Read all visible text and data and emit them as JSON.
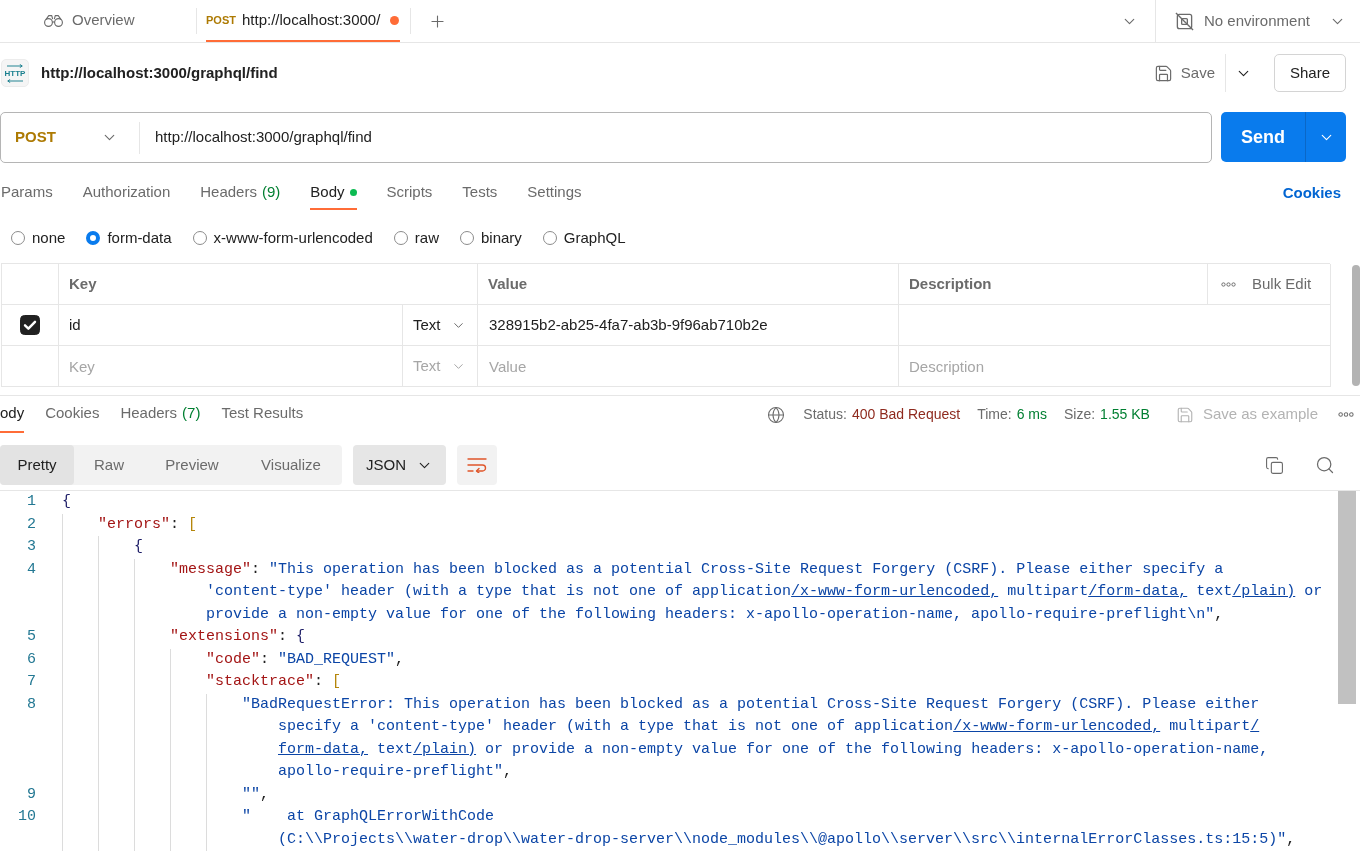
{
  "tabs": [
    {
      "kind": "overview",
      "label": "Overview",
      "selected": false,
      "unsaved": false
    },
    {
      "kind": "request",
      "method": "POST",
      "label": "http://localhost:3000/",
      "selected": true,
      "unsaved": true
    }
  ],
  "environment": {
    "label": "No environment"
  },
  "request": {
    "icon_label": "HTTP",
    "title": "http://localhost:3000/graphql/find",
    "save_label": "Save",
    "share_label": "Share",
    "method": "POST",
    "url": "http://localhost:3000/graphql/find",
    "send_label": "Send"
  },
  "request_tabs": [
    {
      "label": "Params",
      "selected": false,
      "dot": false
    },
    {
      "label": "Authorization",
      "selected": false,
      "dot": false
    },
    {
      "label": "Headers",
      "count": "(9)",
      "selected": false,
      "dot": false
    },
    {
      "label": "Body",
      "selected": true,
      "dot": true
    },
    {
      "label": "Scripts",
      "selected": false,
      "dot": false
    },
    {
      "label": "Tests",
      "selected": false,
      "dot": false
    },
    {
      "label": "Settings",
      "selected": false,
      "dot": false
    }
  ],
  "cookies_link": "Cookies",
  "body_types": [
    {
      "label": "none",
      "selected": false
    },
    {
      "label": "form-data",
      "selected": true
    },
    {
      "label": "x-www-form-urlencoded",
      "selected": false
    },
    {
      "label": "raw",
      "selected": false
    },
    {
      "label": "binary",
      "selected": false
    },
    {
      "label": "GraphQL",
      "selected": false
    }
  ],
  "form_table": {
    "columns": [
      "Key",
      "Value",
      "Description"
    ],
    "bulk_edit": "Bulk Edit",
    "rows": [
      {
        "checked": true,
        "key": "id",
        "type": "Text",
        "value": "328915b2-ab25-4fa7-ab3b-9f96ab710b2e"
      }
    ],
    "new_row": {
      "key_placeholder": "Key",
      "type": "Text",
      "value_placeholder": "Value",
      "description_placeholder": "Description"
    }
  },
  "response": {
    "tabs": [
      {
        "label": "ody",
        "selected": true
      },
      {
        "label": "Cookies",
        "selected": false
      },
      {
        "label": "Headers",
        "count": "(7)",
        "selected": false
      },
      {
        "label": "Test Results",
        "selected": false
      }
    ],
    "status_label": "Status:",
    "status": "400 Bad Request",
    "time_label": "Time:",
    "time": "6 ms",
    "size_label": "Size:",
    "size": "1.55 KB",
    "save_example": {
      "label": "Save as example",
      "disabled": true
    },
    "views": [
      {
        "label": "Pretty",
        "selected": true
      },
      {
        "label": "Raw",
        "selected": false
      },
      {
        "label": "Preview",
        "selected": false
      },
      {
        "label": "Visualize",
        "selected": false
      }
    ],
    "format": "JSON",
    "code_lines": [
      {
        "number": "1",
        "segments": [
          {
            "tokens": [
              {
                "kind": "brace",
                "text": "{"
              }
            ]
          }
        ],
        "children": [
          {
            "number": "2",
            "segments": [
              {
                "tokens": [
                  {
                    "kind": "key",
                    "text": "\"errors\""
                  },
                  {
                    "kind": "punct",
                    "text": ": "
                  },
                  {
                    "kind": "bracket",
                    "text": "["
                  }
                ]
              }
            ],
            "children": [
              {
                "number": "3",
                "segments": [
                  {
                    "tokens": [
                      {
                        "kind": "brace",
                        "text": "{"
                      }
                    ]
                  }
                ],
                "children": [
                  {
                    "number": "4",
                    "segments": [
                      {
                        "tokens": [
                          {
                            "kind": "key",
                            "text": "\"message\""
                          },
                          {
                            "kind": "punct",
                            "text": ": "
                          },
                          {
                            "kind": "string",
                            "text": "\"This operation has been blocked as a potential Cross-Site Request Forgery (CSRF). Please either specify a"
                          }
                        ]
                      },
                      {
                        "tokens": [
                          {
                            "kind": "string",
                            "text": "'content-type' header (with a type that is not one of application"
                          },
                          {
                            "kind": "link",
                            "text": "/x-www-form-urlencoded,"
                          },
                          {
                            "kind": "string",
                            "text": " multipart"
                          },
                          {
                            "kind": "link",
                            "text": "/form-data,"
                          },
                          {
                            "kind": "string",
                            "text": " text"
                          },
                          {
                            "kind": "link",
                            "text": "/plain)"
                          },
                          {
                            "kind": "string",
                            "text": " or"
                          }
                        ]
                      },
                      {
                        "tokens": [
                          {
                            "kind": "string",
                            "text": "provide a non-empty value for one of the following headers: x-apollo-operation-name, apollo-require-preflight\\n\""
                          },
                          {
                            "kind": "punct",
                            "text": ","
                          }
                        ]
                      }
                    ]
                  },
                  {
                    "number": "5",
                    "segments": [
                      {
                        "tokens": [
                          {
                            "kind": "key",
                            "text": "\"extensions\""
                          },
                          {
                            "kind": "punct",
                            "text": ": "
                          },
                          {
                            "kind": "brace",
                            "text": "{"
                          }
                        ]
                      }
                    ],
                    "children": [
                      {
                        "number": "6",
                        "segments": [
                          {
                            "tokens": [
                              {
                                "kind": "key",
                                "text": "\"code\""
                              },
                              {
                                "kind": "punct",
                                "text": ": "
                              },
                              {
                                "kind": "string",
                                "text": "\"BAD_REQUEST\""
                              },
                              {
                                "kind": "punct",
                                "text": ","
                              }
                            ]
                          }
                        ]
                      },
                      {
                        "number": "7",
                        "segments": [
                          {
                            "tokens": [
                              {
                                "kind": "key",
                                "text": "\"stacktrace\""
                              },
                              {
                                "kind": "punct",
                                "text": ": "
                              },
                              {
                                "kind": "bracket",
                                "text": "["
                              }
                            ]
                          }
                        ],
                        "children": [
                          {
                            "number": "8",
                            "segments": [
                              {
                                "tokens": [
                                  {
                                    "kind": "string",
                                    "text": "\"BadRequestError: This operation has been blocked as a potential Cross-Site Request Forgery (CSRF). Please either"
                                  }
                                ]
                              },
                              {
                                "tokens": [
                                  {
                                    "kind": "string",
                                    "text": "specify a 'content-type' header (with a type that is not one of application"
                                  },
                                  {
                                    "kind": "link",
                                    "text": "/x-www-form-urlencoded,"
                                  },
                                  {
                                    "kind": "string",
                                    "text": " multipart"
                                  },
                                  {
                                    "kind": "link",
                                    "text": "/"
                                  }
                                ]
                              },
                              {
                                "tokens": [
                                  {
                                    "kind": "link",
                                    "text": "form-data,"
                                  },
                                  {
                                    "kind": "string",
                                    "text": " text"
                                  },
                                  {
                                    "kind": "link",
                                    "text": "/plain)"
                                  },
                                  {
                                    "kind": "string",
                                    "text": " or provide a non-empty value for one of the following headers: x-apollo-operation-name,"
                                  }
                                ]
                              },
                              {
                                "tokens": [
                                  {
                                    "kind": "string",
                                    "text": "apollo-require-preflight\""
                                  },
                                  {
                                    "kind": "punct",
                                    "text": ","
                                  }
                                ]
                              }
                            ]
                          },
                          {
                            "number": "9",
                            "segments": [
                              {
                                "tokens": [
                                  {
                                    "kind": "string",
                                    "text": "\"\""
                                  },
                                  {
                                    "kind": "punct",
                                    "text": ","
                                  }
                                ]
                              }
                            ]
                          },
                          {
                            "number": "10",
                            "segments": [
                              {
                                "tokens": [
                                  {
                                    "kind": "string",
                                    "text": "\"    at GraphQLErrorWithCode"
                                  }
                                ]
                              },
                              {
                                "tokens": [
                                  {
                                    "kind": "string",
                                    "text": "(C:\\\\Projects\\\\water-drop\\\\water-drop-server\\\\node_modules\\\\@apollo\\\\server\\\\src\\\\internalErrorClasses.ts:15:5)\""
                                  },
                                  {
                                    "kind": "punct",
                                    "text": ","
                                  }
                                ]
                              }
                            ]
                          }
                        ]
                      }
                    ]
                  }
                ]
              }
            ]
          }
        ]
      }
    ]
  }
}
